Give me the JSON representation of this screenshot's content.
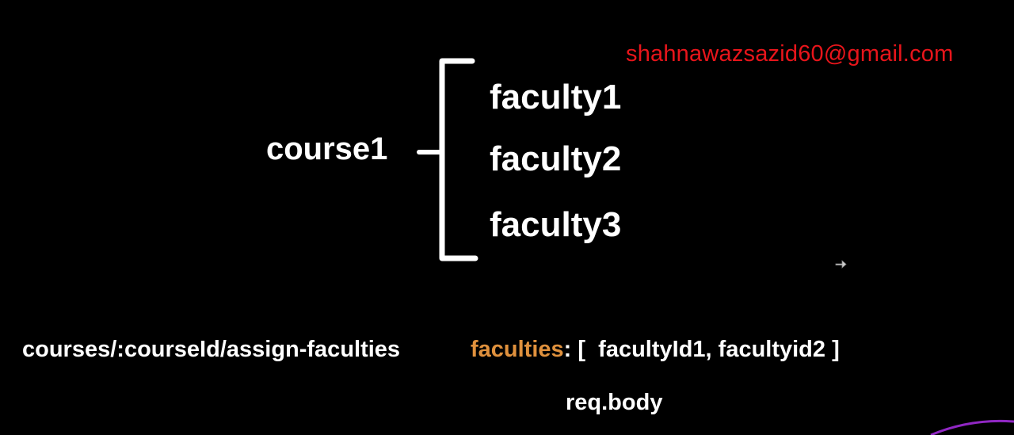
{
  "email": "shahnawazsazid60@gmail.com",
  "diagram": {
    "course": "course1",
    "faculties": [
      "faculty1",
      "faculty2",
      "faculty3"
    ]
  },
  "route": "courses/:courseId/assign-faculties",
  "request_body": {
    "key": "faculties",
    "separator": ": [",
    "values": "facultyId1, facultyid2 ]",
    "caption": "req.body"
  },
  "colors": {
    "background": "#000000",
    "text": "#ffffff",
    "email": "#e8151b",
    "key_highlight": "#e0913d",
    "cursor": "#bbbbbb",
    "corner_glow": "#a02bd8"
  },
  "icons": [
    "mouse-cursor-icon"
  ]
}
